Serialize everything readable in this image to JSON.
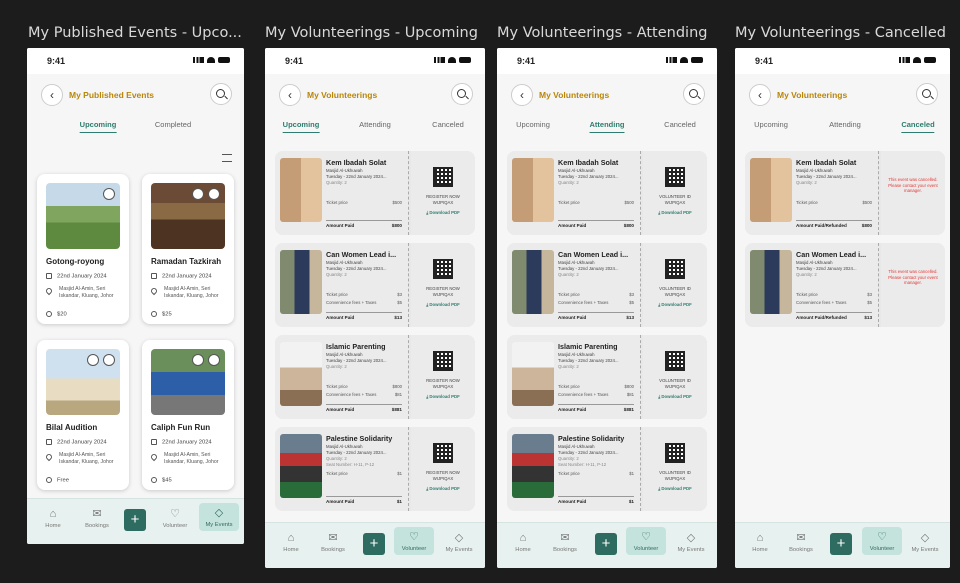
{
  "screens": [
    {
      "caption": "My Published Events - Upco...",
      "time": "9:41",
      "title": "My Published Events",
      "tabs": [
        "Upcoming",
        "Completed"
      ],
      "active_tab": 0,
      "events": [
        {
          "name": "Gotong-royong",
          "date": "22nd January 2024",
          "location": "Masjid Al-Amin, Seri Iskandar, Kluang, Johor",
          "price": "$20"
        },
        {
          "name": "Ramadan Tazkirah",
          "date": "22nd January 2024",
          "location": "Masjid Al-Amin, Seri Iskandar, Kluang, Johor",
          "price": "$25"
        },
        {
          "name": "Bilal Audition",
          "date": "22nd January 2024",
          "location": "Masjid Al-Amin, Seri Iskandar, Kluang, Johor",
          "price": "Free"
        },
        {
          "name": "Caliph Fun Run",
          "date": "22nd January 2024",
          "location": "Masjid Al-Amin, Seri Iskandar, Kluang, Johor",
          "price": "$45"
        }
      ],
      "nav": [
        "Home",
        "Bookings",
        "Volunteer",
        "My Events"
      ],
      "active_nav": 3
    },
    {
      "caption": "My Volunteerings - Upcoming",
      "time": "9:41",
      "title": "My Volunteerings",
      "tabs": [
        "Upcoming",
        "Attending",
        "Canceled"
      ],
      "active_tab": 0,
      "nav": [
        "Home",
        "Bookings",
        "Volunteer",
        "My Events"
      ],
      "active_nav": 2,
      "right_label": "REGISTER NOW\nWIJPIQAX",
      "download": "Download PDF",
      "cards": [
        {
          "name": "Kem Ibadah Solat",
          "venue": "Masjid Al-Ukhuwah",
          "when": "Tuesday - 22nd January 2024...",
          "qty": "Quantity: 2",
          "seat": "",
          "row1": [
            "Ticket price",
            "$500"
          ],
          "row2": [
            "",
            ""
          ],
          "amount_label": "Amount Paid",
          "amount": "$800"
        },
        {
          "name": "Can Women Lead i...",
          "venue": "Masjid Al-Ukhuwah",
          "when": "Tuesday - 22nd January 2024...",
          "qty": "Quantity: 2",
          "seat": "",
          "row1": [
            "Ticket price",
            "$3"
          ],
          "row2": [
            "Convenience fees + Taxes",
            "$5"
          ],
          "amount_label": "Amount Paid",
          "amount": "$13"
        },
        {
          "name": "Islamic Parenting",
          "venue": "Masjid Al-Ukhuwah",
          "when": "Tuesday - 22nd January 2024...",
          "qty": "Quantity: 2",
          "seat": "",
          "row1": [
            "Ticket price",
            "$800"
          ],
          "row2": [
            "Convenience fees + Taxes",
            "$81"
          ],
          "amount_label": "Amount Paid",
          "amount": "$881"
        },
        {
          "name": "Palestine Solidarity",
          "venue": "Masjid Al-Ukhuwah",
          "when": "Tuesday - 22nd January 2024...",
          "qty": "Quantity: 2",
          "seat": "Seat Number: H-11, P-12",
          "row1": [
            "Ticket price",
            "$1"
          ],
          "row2": [
            "",
            ""
          ],
          "amount_label": "Amount Paid",
          "amount": "$1"
        }
      ]
    },
    {
      "caption": "My Volunteerings - Attending",
      "time": "9:41",
      "title": "My Volunteerings",
      "tabs": [
        "Upcoming",
        "Attending",
        "Canceled"
      ],
      "active_tab": 1,
      "nav": [
        "Home",
        "Bookings",
        "Volunteer",
        "My Events"
      ],
      "active_nav": 2,
      "right_label": "VOLUNTEER ID\nWIJPIQAX",
      "download": "Download PDF"
    },
    {
      "caption": "My Volunteerings - Cancelled",
      "time": "9:41",
      "title": "My Volunteerings",
      "tabs": [
        "Upcoming",
        "Attending",
        "Canceled"
      ],
      "active_tab": 2,
      "nav": [
        "Home",
        "Bookings",
        "Volunteer",
        "My Events"
      ],
      "active_nav": 2,
      "cancel_note": "This event was cancelled. Please contact your event manager.",
      "cards": [
        {
          "name": "Kem Ibadah Solat",
          "venue": "Masjid Al-Ukhuwah",
          "when": "Tuesday - 22nd January 2024...",
          "qty": "Quantity: 2",
          "row1": [
            "Ticket price",
            "$500"
          ],
          "row2": [
            "",
            ""
          ],
          "amount_label": "Amount Paid/Refunded",
          "amount": "$800"
        },
        {
          "name": "Can Women Lead i...",
          "venue": "Masjid Al-Ukhuwah",
          "when": "Tuesday - 22nd January 2024...",
          "qty": "Quantity: 2",
          "row1": [
            "Ticket price",
            "$3"
          ],
          "row2": [
            "Convenience fees + Taxes",
            "$5"
          ],
          "amount_label": "Amount Paid/Refunded",
          "amount": "$13"
        }
      ]
    }
  ],
  "colors": {
    "accent": "#2e7d6e",
    "title": "#b8860b",
    "nav_bg": "#e7f1ef",
    "danger": "#e53935"
  }
}
